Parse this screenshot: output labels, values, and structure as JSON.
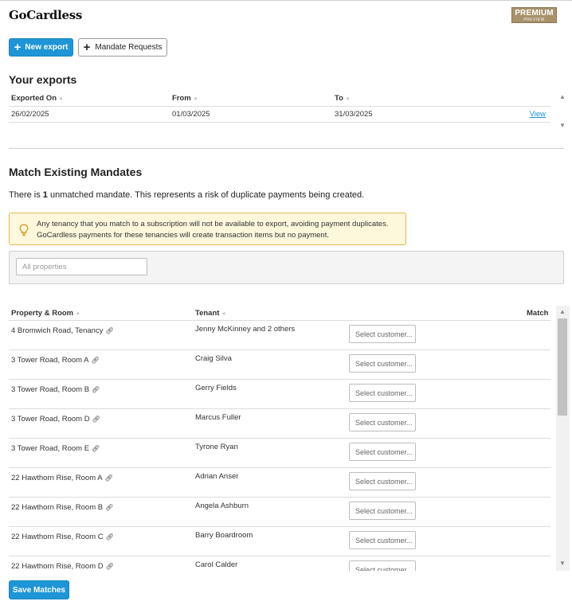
{
  "header": {
    "logo": "GoCardless",
    "badge_title": "PREMIUM",
    "badge_sub": "PREVIEW"
  },
  "toolbar": {
    "new_export": "New export",
    "mandate_requests": "Mandate Requests"
  },
  "exports": {
    "title": "Your exports",
    "columns": [
      "Exported On",
      "From",
      "To"
    ],
    "rows": [
      {
        "exported_on": "26/02/2025",
        "from": "01/03/2025",
        "to": "31/03/2025",
        "action": "View"
      }
    ]
  },
  "match": {
    "title": "Match Existing Mandates",
    "info_prefix": "There is ",
    "info_count": "1",
    "info_suffix": " unmatched mandate. This represents a risk of duplicate payments being created.",
    "notice_line1": "Any tenancy that you match to a subscription will not be available to export, avoiding payment duplicates.",
    "notice_line2": "GoCardless payments for these tenancies will create transaction items but no payment.",
    "filter_placeholder": "All properties",
    "columns": {
      "property": "Property & Room",
      "tenant": "Tenant",
      "match": "Match"
    },
    "select_placeholder": "Select customer...",
    "rows": [
      {
        "property": "4 Bromwich Road, Tenancy",
        "tenant": "Jenny McKinney and 2 others"
      },
      {
        "property": "3 Tower Road, Room A",
        "tenant": "Craig Silva"
      },
      {
        "property": "3 Tower Road, Room B",
        "tenant": "Gerry Fields"
      },
      {
        "property": "3 Tower Road, Room D",
        "tenant": "Marcus Fuller"
      },
      {
        "property": "3 Tower Road, Room E",
        "tenant": "Tyrone Ryan"
      },
      {
        "property": "22 Hawthorn Rise, Room A",
        "tenant": "Adrian Anser"
      },
      {
        "property": "22 Hawthorn Rise, Room B",
        "tenant": "Angela Ashburn"
      },
      {
        "property": "22 Hawthorn Rise, Room C",
        "tenant": "Barry Boardroom"
      },
      {
        "property": "22 Hawthorn Rise, Room D",
        "tenant": "Carol Calder"
      }
    ],
    "save_label": "Save Matches"
  },
  "colors": {
    "accent": "#1e95d6",
    "notice_bg": "#fdf7dc",
    "notice_border": "#e1b94a",
    "badge": "#a7926a"
  }
}
